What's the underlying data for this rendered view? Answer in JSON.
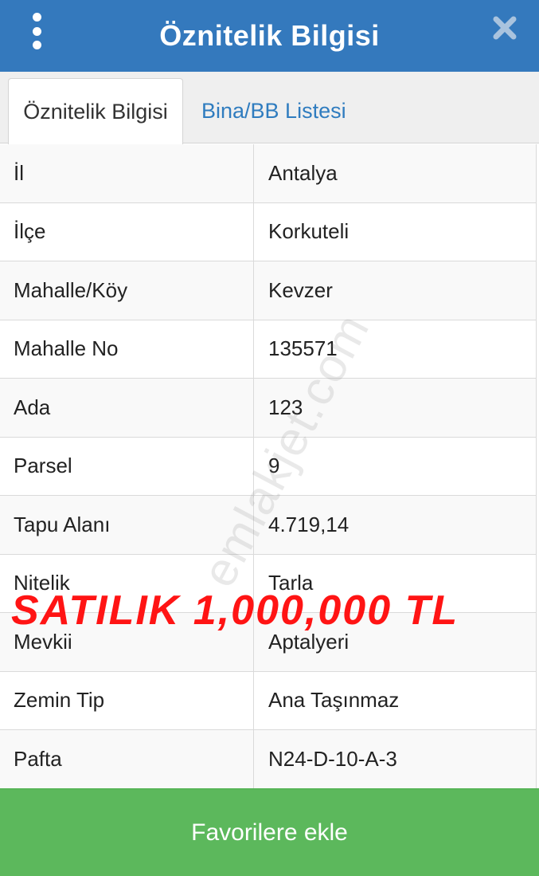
{
  "header": {
    "title": "Öznitelik Bilgisi"
  },
  "tabs": [
    {
      "label": "Öznitelik Bilgisi",
      "active": true
    },
    {
      "label": "Bina/BB Listesi",
      "active": false
    }
  ],
  "rows": [
    {
      "label": "İl",
      "value": "Antalya"
    },
    {
      "label": "İlçe",
      "value": "Korkuteli"
    },
    {
      "label": "Mahalle/Köy",
      "value": "Kevzer"
    },
    {
      "label": "Mahalle No",
      "value": "135571"
    },
    {
      "label": "Ada",
      "value": "123"
    },
    {
      "label": "Parsel",
      "value": "9"
    },
    {
      "label": "Tapu Alanı",
      "value": "4.719,14"
    },
    {
      "label": "Nitelik",
      "value": "Tarla"
    },
    {
      "label": "Mevkii",
      "value": "Aptalyeri"
    },
    {
      "label": "Zemin Tip",
      "value": "Ana Taşınmaz"
    },
    {
      "label": "Pafta",
      "value": "N24-D-10-A-3"
    }
  ],
  "overlay_text": "SATILIK 1,000,000 TL",
  "watermark_text": "emlakjet.com",
  "footer": {
    "button_label": "Favorilere ekle"
  },
  "icons": {
    "menu": "vertical-dots-icon",
    "close": "close-icon"
  },
  "colors": {
    "header": "#3479bd",
    "tab_link": "#2f7cbf",
    "button": "#5cb85c",
    "overlay": "#ff1414"
  }
}
